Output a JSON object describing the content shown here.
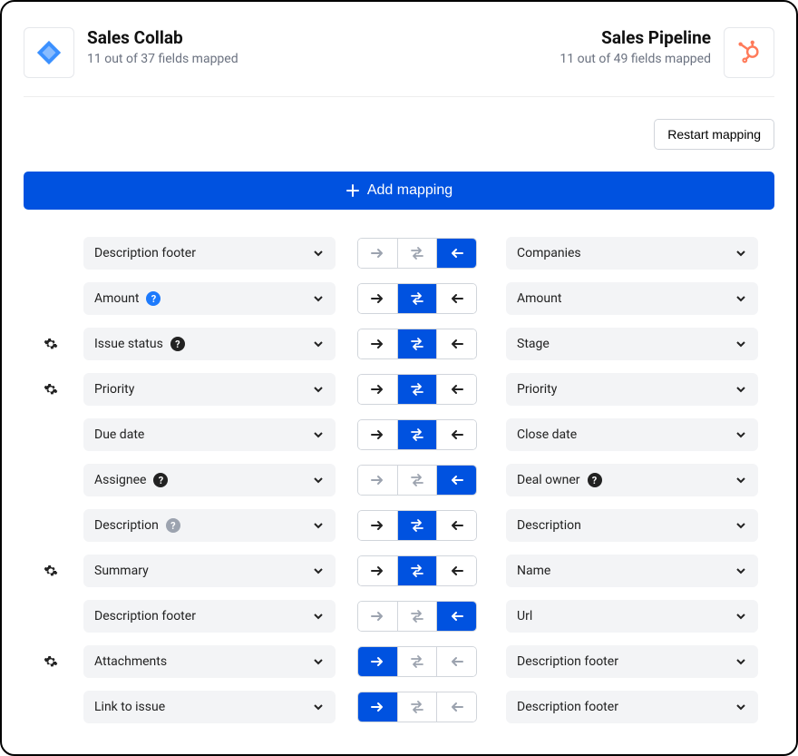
{
  "header": {
    "left": {
      "title": "Sales Collab",
      "subtitle": "11 out of 37 fields mapped"
    },
    "right": {
      "title": "Sales Pipeline",
      "subtitle": "11 out of 49 fields mapped"
    }
  },
  "toolbar": {
    "restart_label": "Restart mapping"
  },
  "add": {
    "label": "Add mapping"
  },
  "rows": [
    {
      "gear": false,
      "left": "Description footer",
      "leftHelp": null,
      "right": "Companies",
      "rightHelp": null,
      "dir": "left",
      "disabled": true
    },
    {
      "gear": false,
      "left": "Amount",
      "leftHelp": "blue",
      "right": "Amount",
      "rightHelp": null,
      "dir": "both",
      "disabled": false
    },
    {
      "gear": true,
      "left": "Issue status",
      "leftHelp": "dark",
      "right": "Stage",
      "rightHelp": null,
      "dir": "both",
      "disabled": false
    },
    {
      "gear": true,
      "left": "Priority",
      "leftHelp": null,
      "right": "Priority",
      "rightHelp": null,
      "dir": "both",
      "disabled": false
    },
    {
      "gear": false,
      "left": "Due date",
      "leftHelp": null,
      "right": "Close date",
      "rightHelp": null,
      "dir": "both",
      "disabled": false
    },
    {
      "gear": false,
      "left": "Assignee",
      "leftHelp": "dark",
      "right": "Deal owner",
      "rightHelp": "dark",
      "dir": "left",
      "disabled": true
    },
    {
      "gear": false,
      "left": "Description",
      "leftHelp": "grey",
      "right": "Description",
      "rightHelp": null,
      "dir": "both",
      "disabled": false
    },
    {
      "gear": true,
      "left": "Summary",
      "leftHelp": null,
      "right": "Name",
      "rightHelp": null,
      "dir": "both",
      "disabled": false
    },
    {
      "gear": false,
      "left": "Description footer",
      "leftHelp": null,
      "right": "Url",
      "rightHelp": null,
      "dir": "left",
      "disabled": true
    },
    {
      "gear": true,
      "left": "Attachments",
      "leftHelp": null,
      "right": "Description footer",
      "rightHelp": null,
      "dir": "right",
      "disabled": true
    },
    {
      "gear": false,
      "left": "Link to issue",
      "leftHelp": null,
      "right": "Description footer",
      "rightHelp": null,
      "dir": "right",
      "disabled": true
    }
  ]
}
